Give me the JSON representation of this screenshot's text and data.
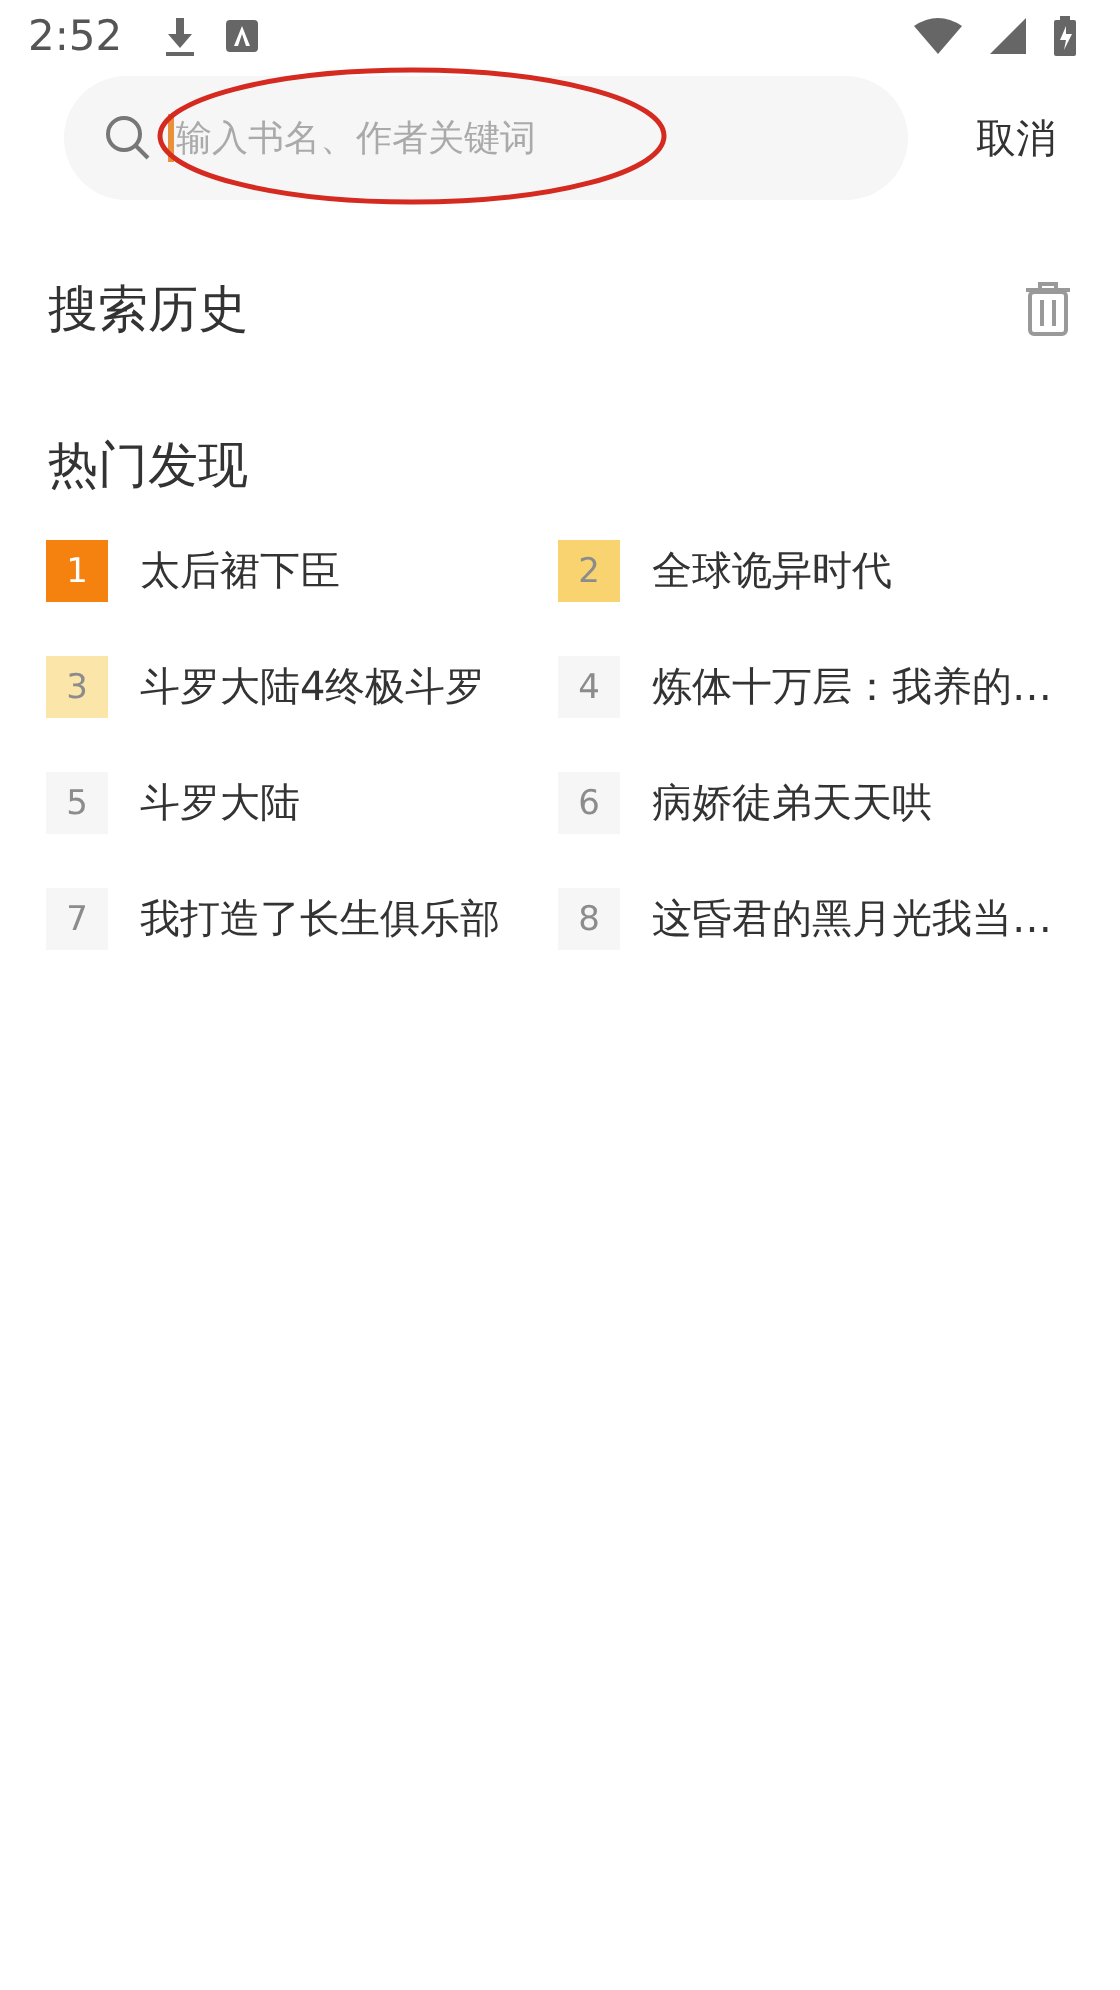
{
  "status_bar": {
    "time": "2:52"
  },
  "search": {
    "placeholder": "输入书名、作者关键词",
    "cancel": "取消"
  },
  "history": {
    "title": "搜索历史"
  },
  "hot": {
    "title": "热门发现",
    "items": [
      {
        "rank": "1",
        "title": "太后裙下臣",
        "color": "#f5820f"
      },
      {
        "rank": "2",
        "title": "全球诡异时代",
        "color": "#f8d36f"
      },
      {
        "rank": "3",
        "title": "斗罗大陆4终极斗罗",
        "color": "#fbe5a9"
      },
      {
        "rank": "4",
        "title": "炼体十万层：我养的…",
        "color": "#f6f6f6"
      },
      {
        "rank": "5",
        "title": "斗罗大陆",
        "color": "#f6f6f6"
      },
      {
        "rank": "6",
        "title": "病娇徒弟天天哄",
        "color": "#f6f6f6"
      },
      {
        "rank": "7",
        "title": "我打造了长生俱乐部",
        "color": "#f6f6f6"
      },
      {
        "rank": "8",
        "title": "这昏君的黑月光我当…",
        "color": "#f6f6f6"
      }
    ]
  }
}
